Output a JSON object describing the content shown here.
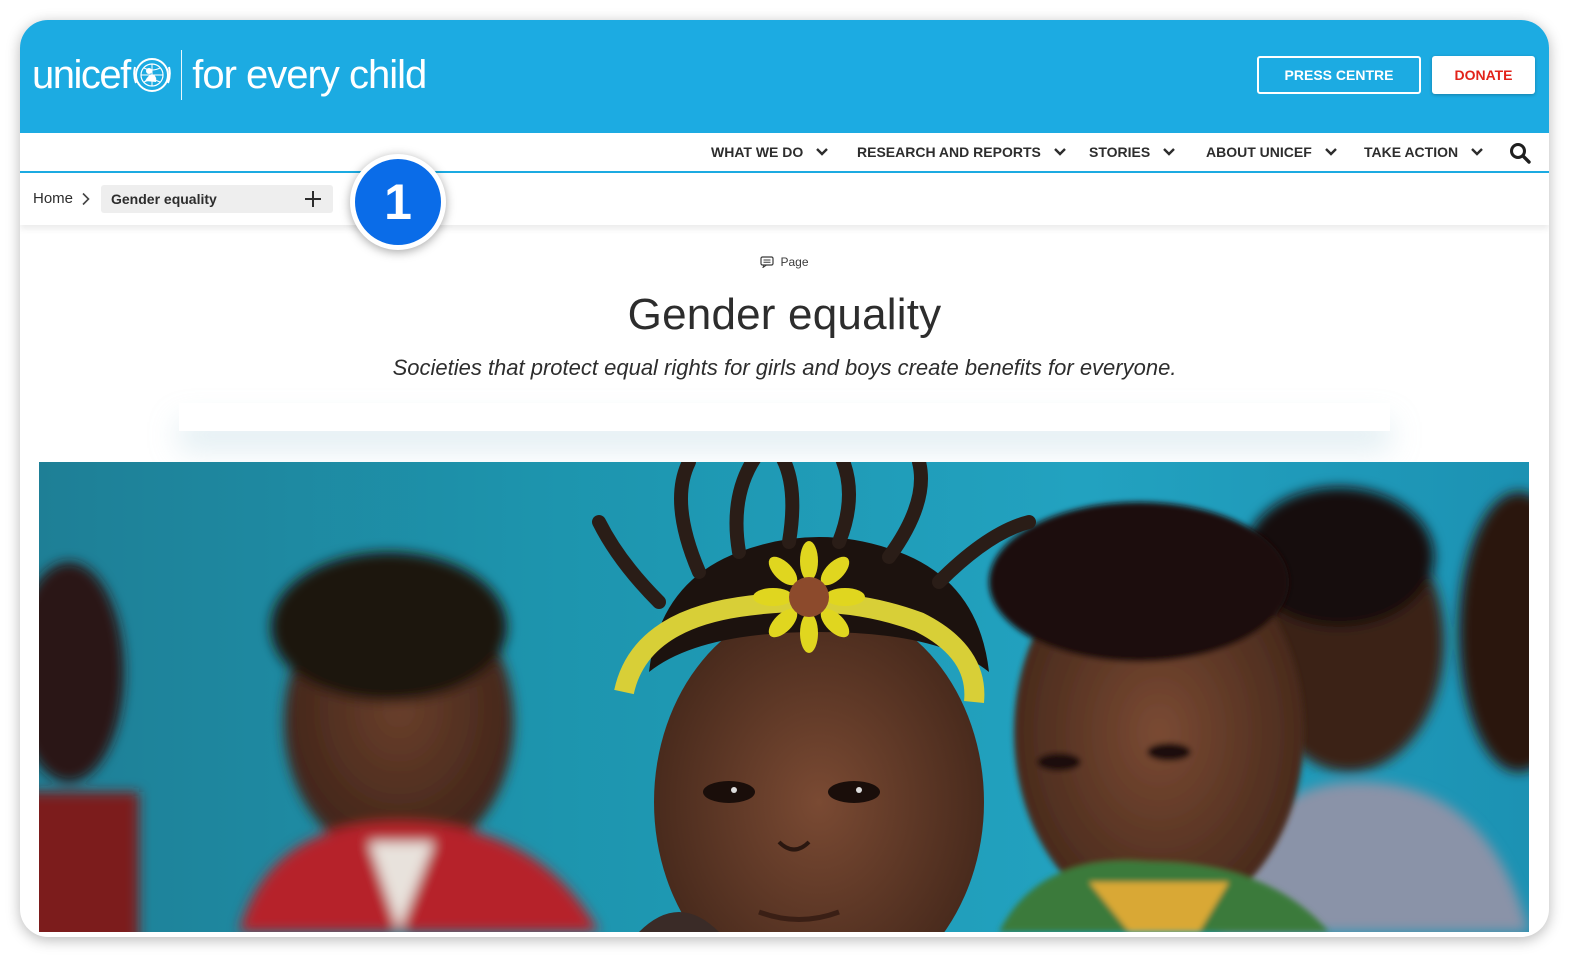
{
  "header": {
    "logo_word": "unicef",
    "logo_tagline": "for every child",
    "press_label": "PRESS CENTRE",
    "donate_label": "DONATE"
  },
  "nav": {
    "items": [
      {
        "label": "WHAT WE DO"
      },
      {
        "label": "RESEARCH AND REPORTS"
      },
      {
        "label": "STORIES"
      },
      {
        "label": "ABOUT UNICEF"
      },
      {
        "label": "TAKE ACTION"
      }
    ],
    "search_icon": "search-icon"
  },
  "breadcrumb": {
    "home": "Home",
    "current": "Gender equality",
    "expand_icon": "plus-icon"
  },
  "callout": {
    "number": "1"
  },
  "content": {
    "type_label": "Page",
    "title": "Gender equality",
    "subtitle": "Societies that protect equal rights for girls and boys create benefits for everyone."
  },
  "colors": {
    "brand_blue": "#1CABE2",
    "donate_red": "#E2231A",
    "callout_blue": "#0A6CE8"
  }
}
